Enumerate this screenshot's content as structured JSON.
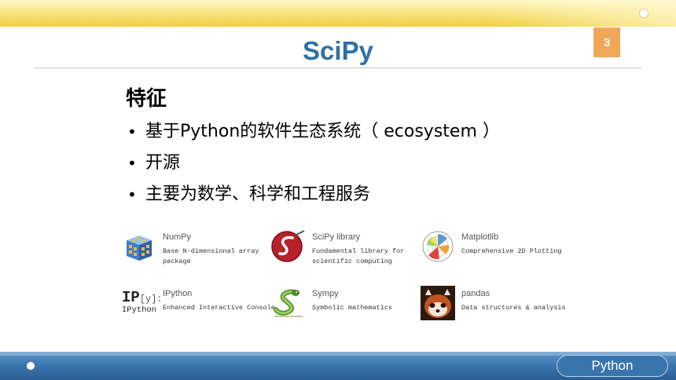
{
  "slide": {
    "page_number": "3",
    "title": "SciPy",
    "heading": "特征",
    "bullets": [
      "基于Python的软件生态系统（ ecosystem ）",
      "开源",
      "主要为数学、科学和工程服务"
    ],
    "footer_label": "Python"
  },
  "libraries": [
    {
      "name": "NumPy",
      "desc": "Base N-dimensional array package",
      "icon": "numpy-cube-icon"
    },
    {
      "name": "SciPy library",
      "desc": "Fundamental library for scientific computing",
      "icon": "scipy-logo-icon"
    },
    {
      "name": "Matplotlib",
      "desc": "Comprehensive 2D Plotting",
      "icon": "matplotlib-logo-icon"
    },
    {
      "name": "IPython",
      "desc": "Enhanced Interactive Console",
      "icon": "ipython-logo-icon",
      "logo_text_main": "IP",
      "logo_text_bracket": "[y]:",
      "logo_text_sub": "IPython"
    },
    {
      "name": "Sympy",
      "desc": "Symbolic mathematics",
      "icon": "sympy-snake-icon"
    },
    {
      "name": "pandas",
      "desc": "Data structures & analysis",
      "icon": "red-panda-icon"
    }
  ],
  "colors": {
    "title": "#2f6fa6",
    "page_badge": "#f0a858",
    "top_band": "#f0cf3f",
    "bottom_band": "#3a74ad"
  }
}
